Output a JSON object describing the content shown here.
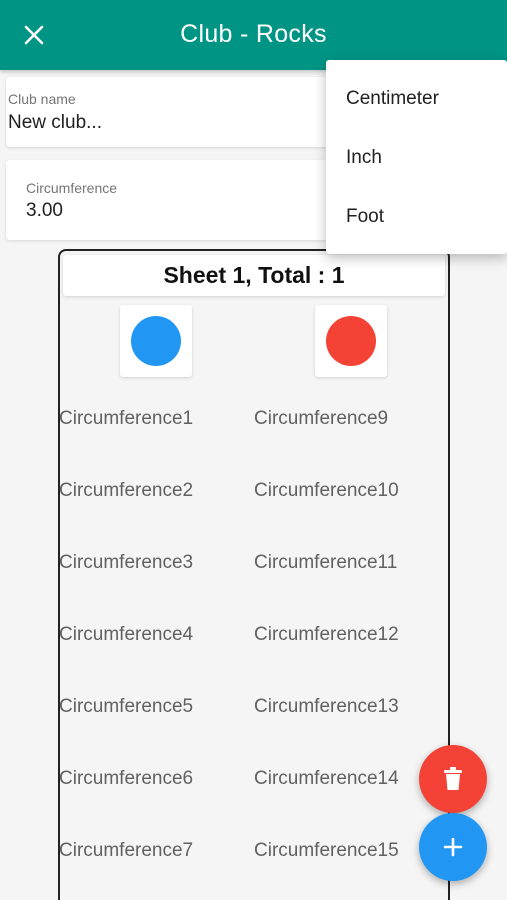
{
  "appbar": {
    "title": "Club - Rocks",
    "color": "#009485",
    "close_icon": "close-icon"
  },
  "club_name": {
    "label": "Club name",
    "value": "New club..."
  },
  "circumference": {
    "label": "Circumference",
    "value": "3.00"
  },
  "unit_menu": {
    "items": [
      "Centimeter",
      "Inch",
      "Foot"
    ]
  },
  "sheet": {
    "title": "Sheet 1, Total : 1",
    "dots": [
      {
        "color": "#2196f3",
        "icon": "blue-dot"
      },
      {
        "color": "#f44336",
        "icon": "red-dot"
      }
    ],
    "columns": [
      [
        "Circumference1",
        "Circumference2",
        "Circumference3",
        "Circumference4",
        "Circumference5",
        "Circumference6",
        "Circumference7"
      ],
      [
        "Circumference9",
        "Circumference10",
        "Circumference11",
        "Circumference12",
        "Circumference13",
        "Circumference14",
        "Circumference15"
      ]
    ]
  },
  "fabs": {
    "delete": {
      "icon": "trash-icon",
      "color": "#f44336"
    },
    "add": {
      "icon": "plus-icon",
      "color": "#2196f3"
    }
  }
}
